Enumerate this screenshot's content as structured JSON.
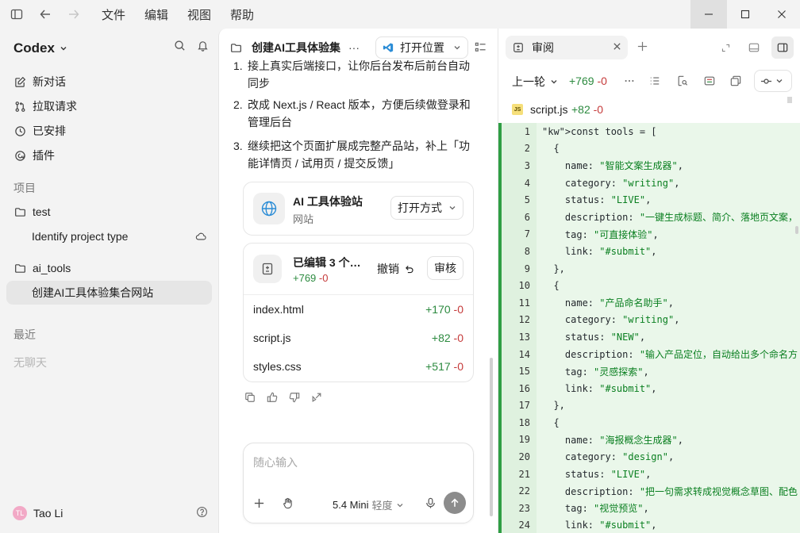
{
  "titlebar": {
    "menu": [
      "文件",
      "编辑",
      "视图",
      "帮助"
    ]
  },
  "sidebar": {
    "app_name": "Codex",
    "nav": [
      {
        "label": "新对话",
        "icon": "edit-icon"
      },
      {
        "label": "拉取请求",
        "icon": "pull-request-icon"
      },
      {
        "label": "已安排",
        "icon": "clock-icon"
      },
      {
        "label": "插件",
        "icon": "plugin-icon"
      }
    ],
    "projects_heading": "项目",
    "projects": [
      {
        "label": "test",
        "icon": "folder-icon"
      },
      {
        "label": "Identify project type",
        "sub": true,
        "cloud": true
      },
      {
        "label": "ai_tools",
        "icon": "folder-icon"
      },
      {
        "label": "创建AI工具体验集合网站",
        "sub": true,
        "active": true
      }
    ],
    "recent_heading": "最近",
    "recent_empty": "无聊天",
    "user": {
      "name": "Tao Li",
      "avatar_text": "TL"
    }
  },
  "middle": {
    "title": "创建AI工具体验集",
    "more": "···",
    "open_location": "打开位置",
    "messages": [
      {
        "num": "1.",
        "text": "接上真实后端接口，让你后台发布后前台自动同步"
      },
      {
        "num": "2.",
        "text": "改成 Next.js / React 版本，方便后续做登录和管理后台"
      },
      {
        "num": "3.",
        "text": "继续把这个页面扩展成完整产品站，补上「功能详情页 / 试用页 / 提交反馈」"
      }
    ],
    "site_card": {
      "title": "AI 工具体验站",
      "subtitle": "网站",
      "open_with": "打开方式"
    },
    "edit_card": {
      "title": "已编辑 3 个…",
      "added": "+769",
      "removed": "-0",
      "undo": "撤销",
      "review": "审核",
      "files": [
        {
          "name": "index.html",
          "added": "+170",
          "removed": "-0"
        },
        {
          "name": "script.js",
          "added": "+82",
          "removed": "-0"
        },
        {
          "name": "styles.css",
          "added": "+517",
          "removed": "-0"
        }
      ]
    },
    "composer": {
      "placeholder": "随心输入",
      "model": "5.4 Mini",
      "effort": "轻度"
    }
  },
  "right": {
    "tab_label": "审阅",
    "prev_round": "上一轮",
    "added": "+769",
    "removed": "-0",
    "file": {
      "name": "script.js",
      "added": "+82",
      "removed": "-0",
      "badge": "JS"
    },
    "code_lines": [
      "const tools = [",
      "  {",
      "    name: \"智能文案生成器\",",
      "    category: \"writing\",",
      "    status: \"LIVE\",",
      "    description: \"一键生成标题、简介、落地页文案，",
      "    tag: \"可直接体验\",",
      "    link: \"#submit\",",
      "  },",
      "  {",
      "    name: \"产品命名助手\",",
      "    category: \"writing\",",
      "    status: \"NEW\",",
      "    description: \"输入产品定位，自动给出多个命名方",
      "    tag: \"灵感探索\",",
      "    link: \"#submit\",",
      "  },",
      "  {",
      "    name: \"海报概念生成器\",",
      "    category: \"design\",",
      "    status: \"LIVE\",",
      "    description: \"把一句需求转成视觉概念草图、配色",
      "    tag: \"视觉预览\",",
      "    link: \"#submit\","
    ],
    "line_numbers": [
      "1",
      "2",
      "3",
      "4",
      "5",
      "6",
      "7",
      "8",
      "9",
      "10",
      "11",
      "12",
      "13",
      "14",
      "15",
      "16",
      "17",
      "18",
      "19",
      "20",
      "21",
      "22",
      "23",
      "24"
    ]
  }
}
